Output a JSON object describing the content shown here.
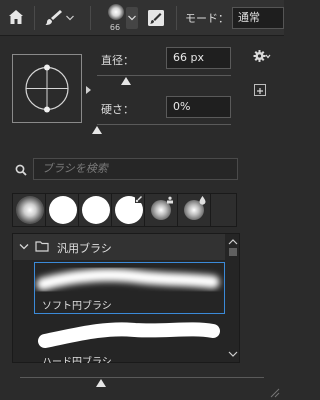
{
  "toolbar": {
    "preset_size": "66",
    "mode_label": "モード：",
    "mode_value": "通常"
  },
  "brush_settings": {
    "size_label": "直径：",
    "size_value": "66 px",
    "size_fraction": 0.22,
    "hardness_label": "硬さ：",
    "hardness_value": "0%",
    "hardness_fraction": 0.0
  },
  "search": {
    "placeholder": "ブラシを検索"
  },
  "brush_list": {
    "group_name": "汎用ブラシ",
    "brushes": [
      {
        "name": "ソフト円ブラシ",
        "selected": true
      },
      {
        "name": "ハード円ブラシ",
        "selected": false
      }
    ]
  },
  "preview_size_fraction": 0.33,
  "colors": {
    "selection": "#3b8ad8",
    "panel_bg": "#2b2b2b"
  }
}
